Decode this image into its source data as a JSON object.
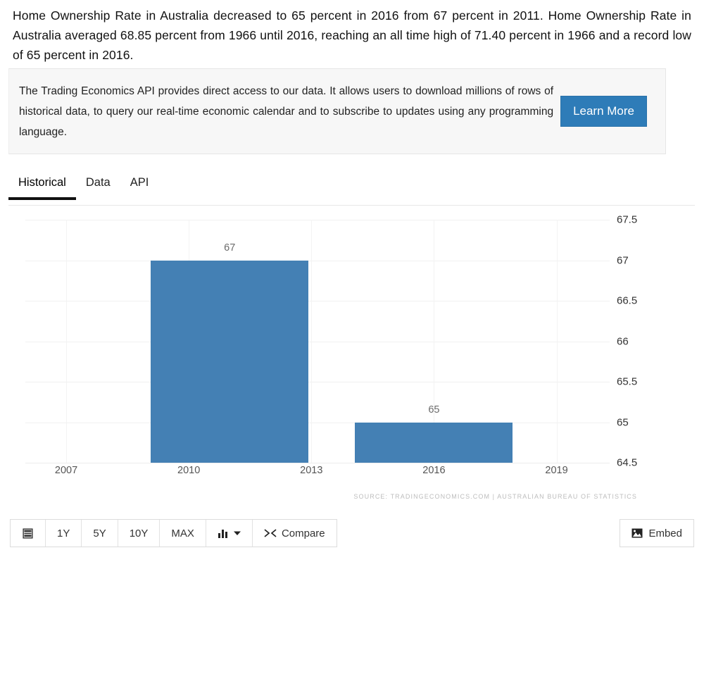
{
  "intro": {
    "text": "Home Ownership Rate in Australia decreased to 65 percent in 2016 from 67 percent in 2011. Home Ownership Rate in Australia averaged 68.85 percent from 1966 until 2016, reaching an all time high of 71.40 percent in 1966 and a record low of 65 percent in 2016."
  },
  "banner": {
    "text": "The Trading Economics API provides direct access to our data. It allows users to download millions of rows of historical data, to query our real-time economic calendar and to subscribe to updates using any programming language.",
    "button_label": "Learn More",
    "button_color": "#2e7cb8"
  },
  "tabs": [
    {
      "label": "Historical",
      "active": true
    },
    {
      "label": "Data",
      "active": false
    },
    {
      "label": "API",
      "active": false
    }
  ],
  "toolbar": {
    "calendar_icon": "calendar-icon",
    "ranges": [
      "1Y",
      "5Y",
      "10Y",
      "MAX"
    ],
    "chart_type_icon": "bar-chart-icon",
    "chart_type_caret": "chevron-down-icon",
    "compare_icon": "shuffle-icon",
    "compare_label": "Compare",
    "embed_icon": "image-icon",
    "embed_label": "Embed"
  },
  "chart_data": {
    "type": "bar",
    "title": "",
    "xlabel": "",
    "ylabel": "",
    "categories": [
      "2011",
      "2016"
    ],
    "values": [
      67,
      65
    ],
    "bar_color": "#4480b4",
    "x_positions": [
      2011,
      2016
    ],
    "xlim": [
      2006,
      2020.3
    ],
    "ylim": [
      64.5,
      67.5
    ],
    "yticks": [
      "67.5",
      "67",
      "66.5",
      "66",
      "65.5",
      "65",
      "64.5"
    ],
    "ytick_values": [
      67.5,
      67,
      66.5,
      66,
      65.5,
      65,
      64.5
    ],
    "xticks": [
      "2007",
      "2010",
      "2013",
      "2016",
      "2019"
    ],
    "xtick_values": [
      2007,
      2010,
      2013,
      2016,
      2019
    ],
    "data_labels": [
      "67",
      "65"
    ],
    "grid": true,
    "legend": "none",
    "source": "SOURCE: TRADINGECONOMICS.COM | AUSTRALIAN BUREAU OF STATISTICS"
  }
}
